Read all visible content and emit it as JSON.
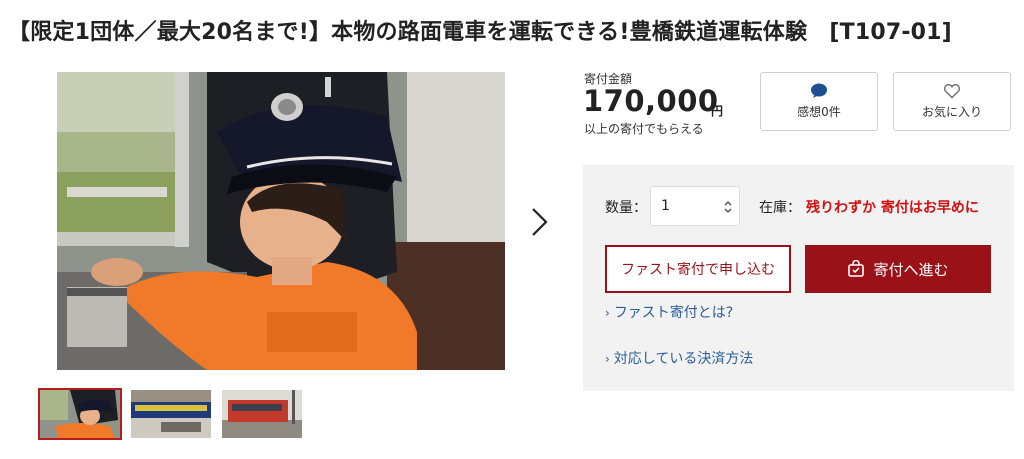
{
  "product": {
    "title": "【限定1団体／最大20名まで!】本物の路面電車を運転できる!豊橋鉄道運転体験　[T107-01]"
  },
  "donation": {
    "label": "寄付金額",
    "amount": "170,000",
    "unit": "円",
    "note": "以上の寄付でもらえる"
  },
  "actions": {
    "review_label": "感想0件",
    "favorite_label": "お気に入り"
  },
  "order": {
    "quantity_label": "数量：",
    "quantity_value": "1",
    "stock_label": "在庫：",
    "stock_value": "残りわずか 寄付はお早めに",
    "fast_button": "ファスト寄付で申し込む",
    "proceed_button": "寄付へ進む",
    "links": [
      "ファスト寄付とは?",
      "対応している決済方法"
    ]
  },
  "colors": {
    "accent": "#9b1118",
    "stock_warning": "#d10f0f",
    "link": "#2c5d9a",
    "panel_bg": "#f2f2f2"
  }
}
